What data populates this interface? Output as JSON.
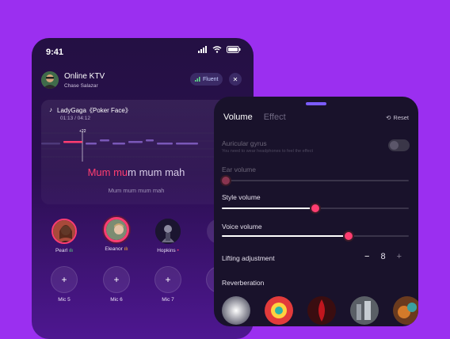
{
  "status_bar": {
    "time": "9:41"
  },
  "room": {
    "title": "Online KTV",
    "host": "Chase Salazar",
    "mode_badge": "Fluent"
  },
  "song": {
    "title": "LadyGaga《Poker Face》",
    "progress": "01:13 / 04:12",
    "pitch_offset": "+22"
  },
  "lyrics": {
    "current_sung": "Mum mu",
    "current_rest": "m mum mah",
    "next": "Mum mum mum mah"
  },
  "seats": [
    {
      "name": "Pearl"
    },
    {
      "name": "Eleanor"
    },
    {
      "name": "Hopkins"
    }
  ],
  "mics": [
    {
      "label": "Mic 5"
    },
    {
      "label": "Mic 6"
    },
    {
      "label": "Mic 7"
    }
  ],
  "panel": {
    "tabs": [
      "Volume",
      "Effect"
    ],
    "reset_label": "Reset",
    "auricular": {
      "label": "Auricular gyrus",
      "hint": "You need to wear headphones to feel the effect",
      "enabled": false
    },
    "ear_volume": {
      "label": "Ear volume",
      "value": 0.02
    },
    "style_volume": {
      "label": "Style volume",
      "value": 0.5
    },
    "voice_volume": {
      "label": "Voice volume",
      "value": 0.68
    },
    "lifting": {
      "label": "Lifting adjustment",
      "value": "8",
      "minus": "−",
      "plus": "+"
    },
    "reverberation_label": "Reverberation"
  },
  "colors": {
    "accent": "#ff3d71",
    "background": "#9b2ff0",
    "panel": "#19122b"
  }
}
